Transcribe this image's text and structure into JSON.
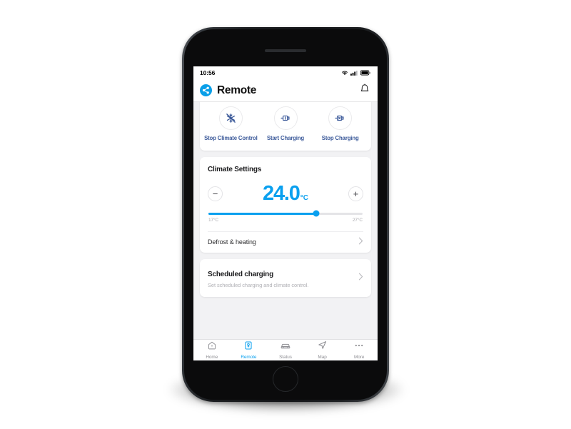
{
  "device": {
    "frame": "iphone-home-button",
    "accent_color": "#0aa0ef",
    "action_label_color": "#3c5a9a"
  },
  "status_bar": {
    "time": "10:56",
    "icons": [
      "wifi-icon",
      "cellular-signal-icon",
      "battery-icon"
    ]
  },
  "nav": {
    "brand_icon": "share-nodes-icon",
    "title": "Remote",
    "notification_icon": "bell-icon"
  },
  "actions": {
    "items": [
      {
        "icon": "climate-off-icon",
        "label": "Stop Climate Control"
      },
      {
        "icon": "plug-start-icon",
        "label": "Start Charging"
      },
      {
        "icon": "plug-stop-icon",
        "label": "Stop Charging"
      }
    ]
  },
  "climate": {
    "title": "Climate Settings",
    "decrease_label": "−",
    "increase_label": "+",
    "temperature": "24.0",
    "unit": "°C",
    "slider": {
      "min_label": "17°C",
      "max_label": "27°C",
      "min": 17,
      "max": 27,
      "value": 24,
      "percent": 70
    },
    "defrost_row": {
      "label": "Defrost & heating",
      "chevron": "chevron-right-icon"
    }
  },
  "scheduled": {
    "title": "Scheduled charging",
    "subtitle": "Set scheduled charging and climate control.",
    "chevron": "chevron-right-icon"
  },
  "tabbar": {
    "items": [
      {
        "icon": "home-icon",
        "label": "Home",
        "active": false
      },
      {
        "icon": "remote-icon",
        "label": "Remote",
        "active": true
      },
      {
        "icon": "car-icon",
        "label": "Status",
        "active": false
      },
      {
        "icon": "map-arrow-icon",
        "label": "Map",
        "active": false
      },
      {
        "icon": "ellipsis-icon",
        "label": "More",
        "active": false
      }
    ]
  }
}
